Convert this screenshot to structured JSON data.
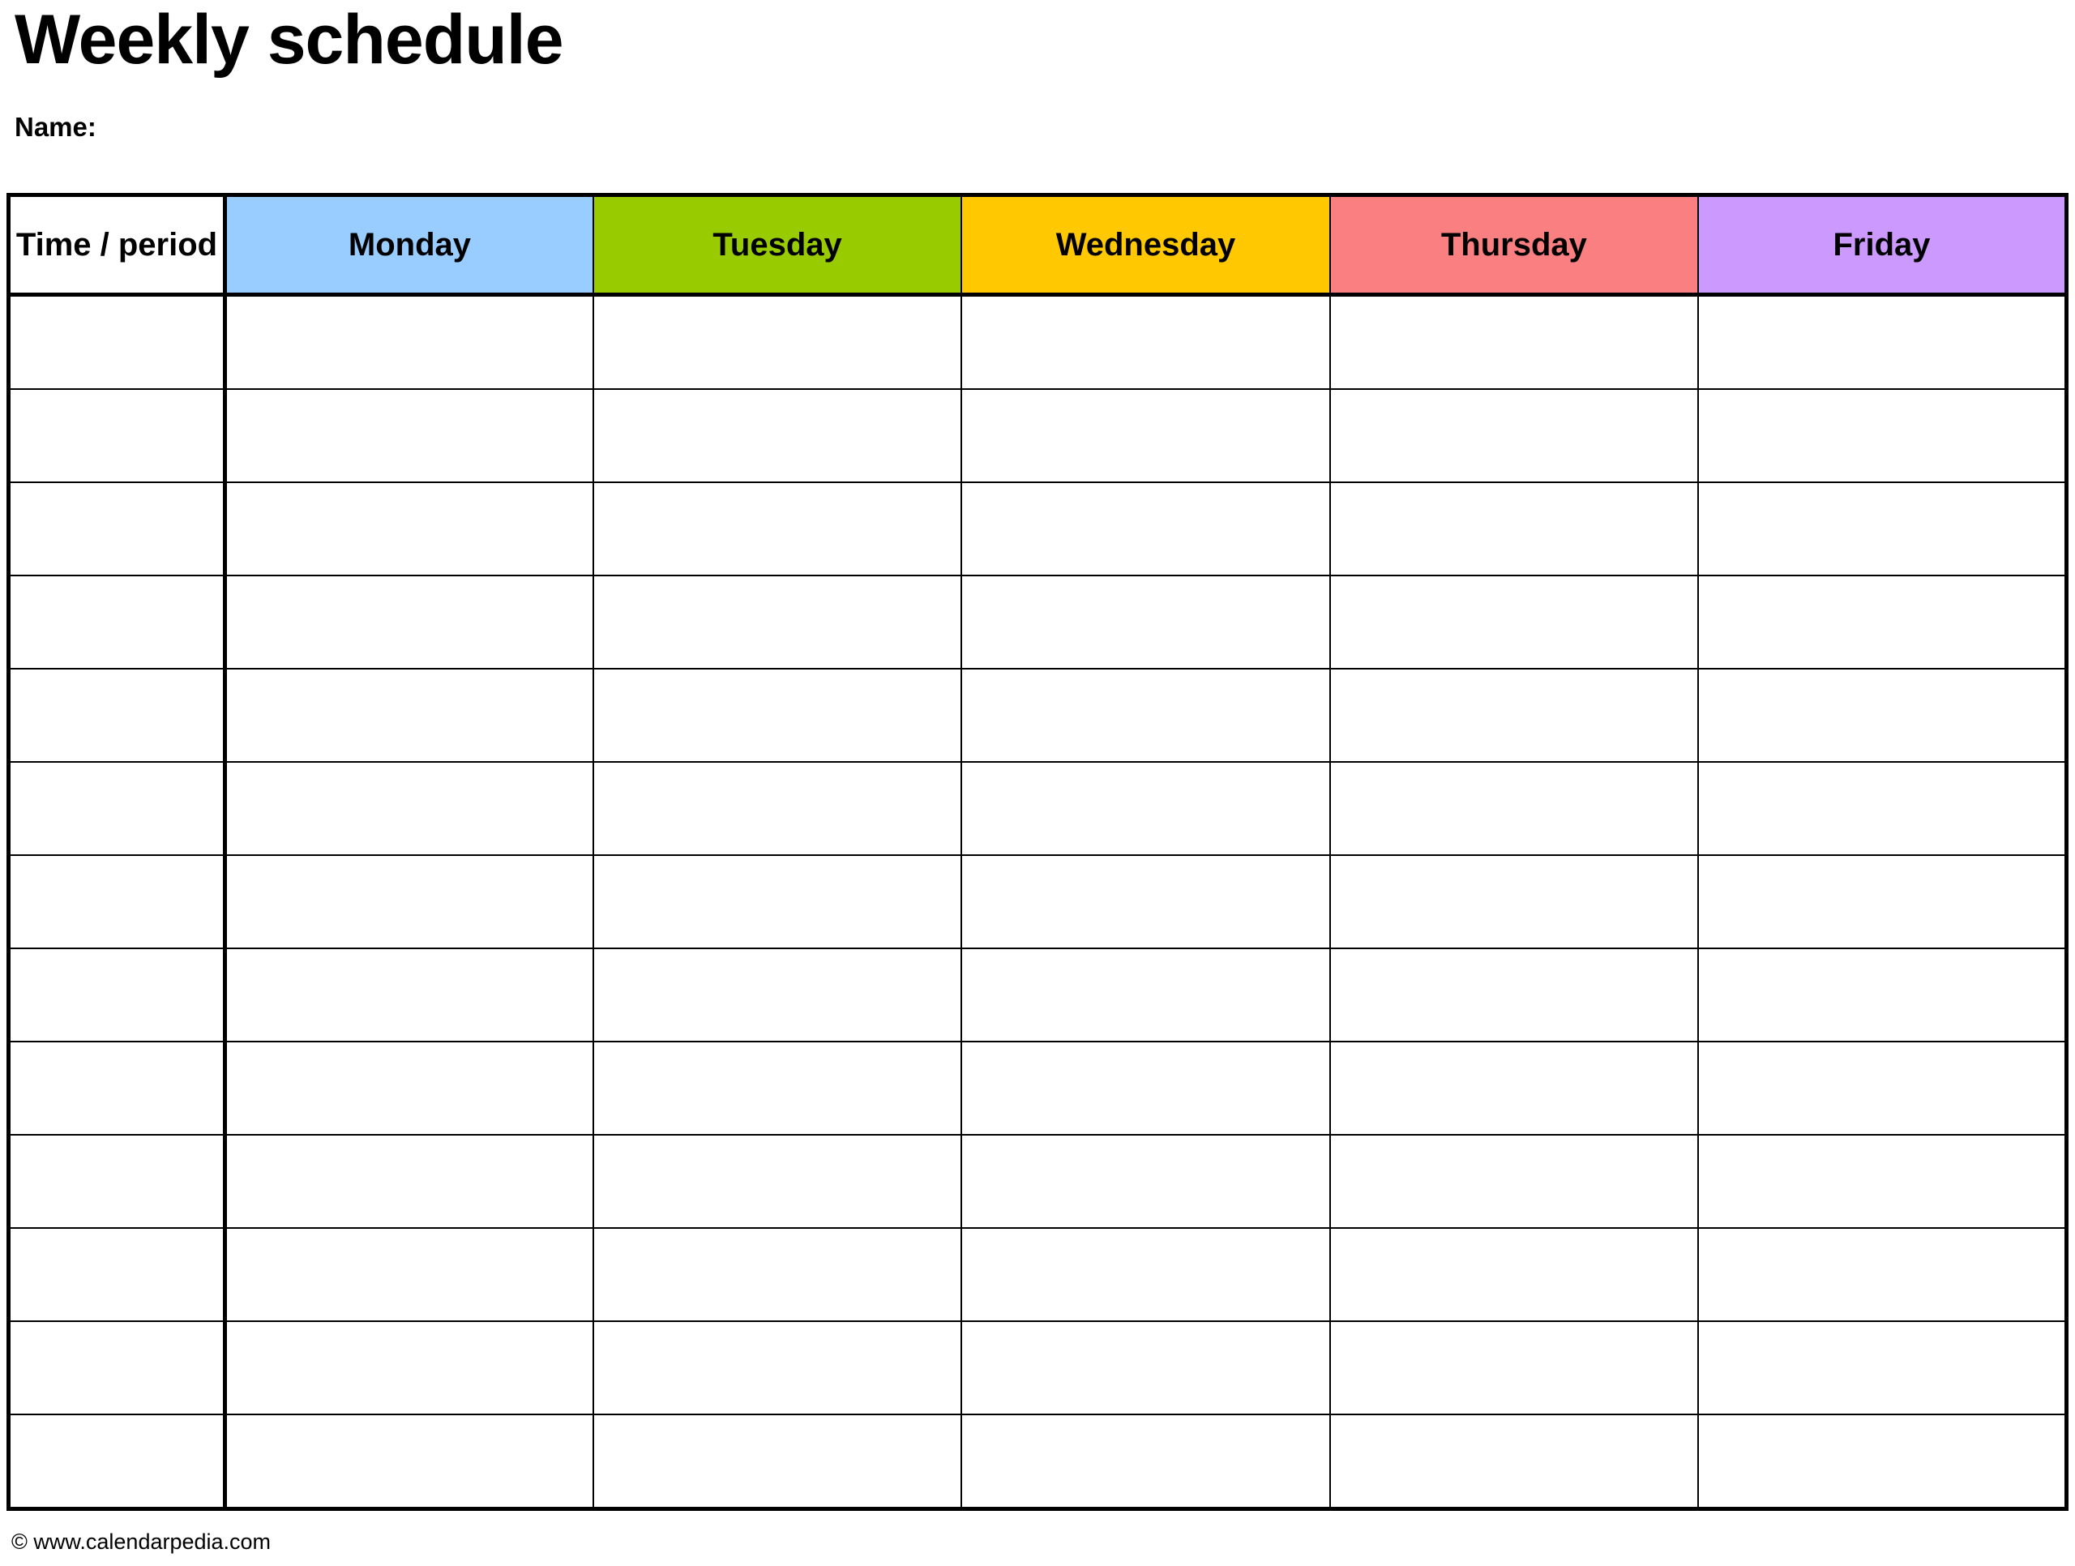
{
  "document": {
    "title": "Weekly schedule",
    "name_label": "Name:"
  },
  "table": {
    "time_column_header": "Time / period",
    "days": [
      {
        "label": "Monday",
        "color": "#99CCFF"
      },
      {
        "label": "Tuesday",
        "color": "#99CC00"
      },
      {
        "label": "Wednesday",
        "color": "#FFC800"
      },
      {
        "label": "Thursday",
        "color": "#FA7F80"
      },
      {
        "label": "Friday",
        "color": "#CC99FF"
      }
    ],
    "row_count": 13,
    "rows": [
      {
        "time": "",
        "cells": [
          "",
          "",
          "",
          "",
          ""
        ]
      },
      {
        "time": "",
        "cells": [
          "",
          "",
          "",
          "",
          ""
        ]
      },
      {
        "time": "",
        "cells": [
          "",
          "",
          "",
          "",
          ""
        ]
      },
      {
        "time": "",
        "cells": [
          "",
          "",
          "",
          "",
          ""
        ]
      },
      {
        "time": "",
        "cells": [
          "",
          "",
          "",
          "",
          ""
        ]
      },
      {
        "time": "",
        "cells": [
          "",
          "",
          "",
          "",
          ""
        ]
      },
      {
        "time": "",
        "cells": [
          "",
          "",
          "",
          "",
          ""
        ]
      },
      {
        "time": "",
        "cells": [
          "",
          "",
          "",
          "",
          ""
        ]
      },
      {
        "time": "",
        "cells": [
          "",
          "",
          "",
          "",
          ""
        ]
      },
      {
        "time": "",
        "cells": [
          "",
          "",
          "",
          "",
          ""
        ]
      },
      {
        "time": "",
        "cells": [
          "",
          "",
          "",
          "",
          ""
        ]
      },
      {
        "time": "",
        "cells": [
          "",
          "",
          "",
          "",
          ""
        ]
      },
      {
        "time": "",
        "cells": [
          "",
          "",
          "",
          "",
          ""
        ]
      }
    ]
  },
  "footer": {
    "copyright": "© www.calendarpedia.com"
  },
  "colors": {
    "border": "#000000",
    "page_background": "#ffffff",
    "text": "#000000"
  }
}
